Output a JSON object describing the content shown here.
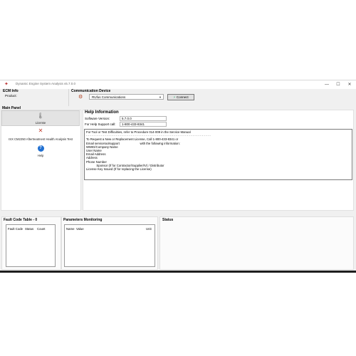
{
  "window": {
    "title": "Dynamic Engine System Analysis v5.7.0.0",
    "controls": [
      "—",
      "☐",
      "✕"
    ]
  },
  "ecm_info": {
    "label": "ECM Info",
    "product_label": "Product:"
  },
  "communication": {
    "label": "Communication Device",
    "selected_device": "RUfus Communications",
    "connect_label": "Connect"
  },
  "main_panel": {
    "label": "Main Panel"
  },
  "nav": {
    "items": [
      {
        "label": "License"
      },
      {
        "label": "ISX CM2250 Aftertreatment Health Analysis Test"
      },
      {
        "label": "Help"
      }
    ]
  },
  "help": {
    "title": "Help Information",
    "software_version_label": "Software Version:",
    "software_version_value": "5.7.0.0",
    "support_label": "For Help Support call:",
    "support_value": "1-800-433-8341",
    "lines": [
      "For Tool or Test Difficulties, refer to Procedure 014-009 in the Service Manual",
      "- - - - - - - - - - - - - - - - - - - - - - - - - - - - - - - - - - - - - - - - - - - - - - - - - - - - - - - - - - - - - - - - - - -",
      "To Request a New or Replacement License, Call 1-800-433-8341 or",
      "Email servicetoolsupport                        with the following information:",
      "WWID/Company Name",
      "User Name",
      "Email Address",
      "Address",
      "Phone Number",
      "            Sponsor (If for Contractor/Supplier/IV) / Distributor",
      "License Key Issued (If for replacing the License)"
    ]
  },
  "fault_code": {
    "label": "Fault Code Table - 0",
    "columns": [
      "Fault Code",
      "Status",
      "Count"
    ]
  },
  "parameters": {
    "label": "Parameters Monitoring",
    "columns": [
      "Name",
      "Value",
      "Unit"
    ]
  },
  "status": {
    "label": "Status"
  },
  "colors": {
    "background": "#f0f0f0",
    "panel": "#ffffff",
    "accent": "#1f6fd1"
  }
}
